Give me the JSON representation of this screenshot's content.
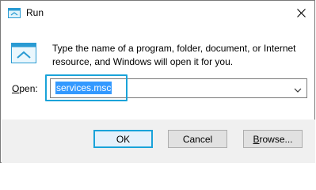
{
  "window": {
    "title": "Run",
    "app_icon": "run-icon",
    "close_icon": "close-icon"
  },
  "prompt": {
    "line1": "Type the name of a program, folder, document, or Internet",
    "line2": "resource, and Windows will open it for you."
  },
  "open_field": {
    "label_access_key": "O",
    "label_rest": "pen:",
    "value": "services.msc",
    "dropdown_icon": "chevron-down-icon"
  },
  "buttons": {
    "ok": "OK",
    "cancel": "Cancel",
    "browse_access_key": "B",
    "browse_rest": "rowse..."
  },
  "colors": {
    "highlight": "#1aa3d9",
    "selection": "#3399ff",
    "footer": "#f0f0f0"
  }
}
